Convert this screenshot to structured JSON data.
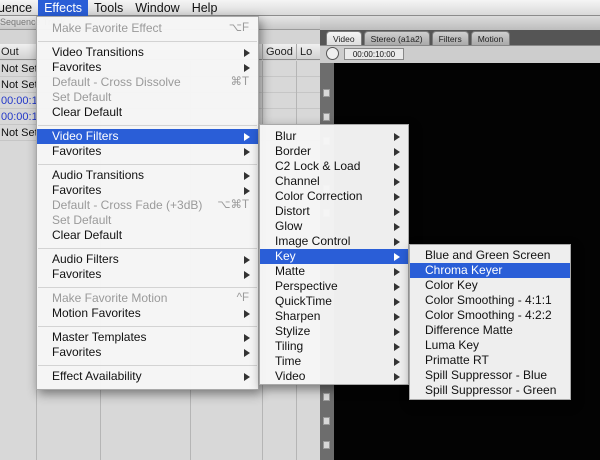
{
  "menubar": {
    "items": [
      {
        "label": "uence",
        "active": false
      },
      {
        "label": "Effects",
        "active": true
      },
      {
        "label": "Tools",
        "active": false
      },
      {
        "label": "Window",
        "active": false
      },
      {
        "label": "Help",
        "active": false
      }
    ]
  },
  "background": {
    "browser_tab": "Sequence Track",
    "columns": [
      "Out",
      "Good",
      "Lo"
    ],
    "rows": [
      "Not Set",
      "Not Set",
      "00:00:1",
      "00:00:1",
      "Not Set"
    ],
    "viewer_tabs": [
      "Video",
      "Stereo (a1a2)",
      "Filters",
      "Motion"
    ],
    "timecode": "00:00:10:00"
  },
  "effects_menu": {
    "items": [
      {
        "label": "Make Favorite Effect",
        "shortcut": "⌥F",
        "disabled": true
      },
      {
        "label": "Video Transitions",
        "submenu": true
      },
      {
        "label": "Favorites",
        "submenu": true
      },
      {
        "label": "Default - Cross Dissolve",
        "shortcut": "⌘T",
        "disabled": true
      },
      {
        "label": "Set Default",
        "disabled": true
      },
      {
        "label": "Clear Default"
      },
      {
        "label": "Video Filters",
        "submenu": true,
        "highlighted": true
      },
      {
        "label": "Favorites",
        "submenu": true
      },
      {
        "label": "Audio Transitions",
        "submenu": true
      },
      {
        "label": "Favorites",
        "submenu": true
      },
      {
        "label": "Default - Cross Fade (+3dB)",
        "shortcut": "⌥⌘T",
        "disabled": true
      },
      {
        "label": "Set Default",
        "disabled": true
      },
      {
        "label": "Clear Default"
      },
      {
        "label": "Audio Filters",
        "submenu": true
      },
      {
        "label": "Favorites",
        "submenu": true
      },
      {
        "label": "Make Favorite Motion",
        "shortcut": "^F",
        "disabled": true
      },
      {
        "label": "Motion Favorites",
        "submenu": true
      },
      {
        "label": "Master Templates",
        "submenu": true
      },
      {
        "label": "Favorites",
        "submenu": true
      },
      {
        "label": "Effect Availability",
        "submenu": true
      }
    ]
  },
  "video_filters_menu": {
    "items": [
      {
        "label": "Blur"
      },
      {
        "label": "Border"
      },
      {
        "label": "C2 Lock & Load"
      },
      {
        "label": "Channel"
      },
      {
        "label": "Color Correction"
      },
      {
        "label": "Distort"
      },
      {
        "label": "Glow"
      },
      {
        "label": "Image Control"
      },
      {
        "label": "Key",
        "highlighted": true
      },
      {
        "label": "Matte"
      },
      {
        "label": "Perspective"
      },
      {
        "label": "QuickTime"
      },
      {
        "label": "Sharpen"
      },
      {
        "label": "Stylize"
      },
      {
        "label": "Tiling"
      },
      {
        "label": "Time"
      },
      {
        "label": "Video"
      }
    ]
  },
  "key_menu": {
    "items": [
      {
        "label": "Blue and Green Screen"
      },
      {
        "label": "Chroma Keyer",
        "highlighted": true
      },
      {
        "label": "Color Key"
      },
      {
        "label": "Color Smoothing - 4:1:1"
      },
      {
        "label": "Color Smoothing - 4:2:2"
      },
      {
        "label": "Difference Matte"
      },
      {
        "label": "Luma Key"
      },
      {
        "label": "Primatte RT"
      },
      {
        "label": "Spill Suppressor - Blue"
      },
      {
        "label": "Spill Suppressor - Green"
      }
    ]
  },
  "colors": {
    "highlight": "#2a5ed7",
    "menu_bg": "#f6f6f6",
    "disabled_text": "#9a9a9a"
  }
}
